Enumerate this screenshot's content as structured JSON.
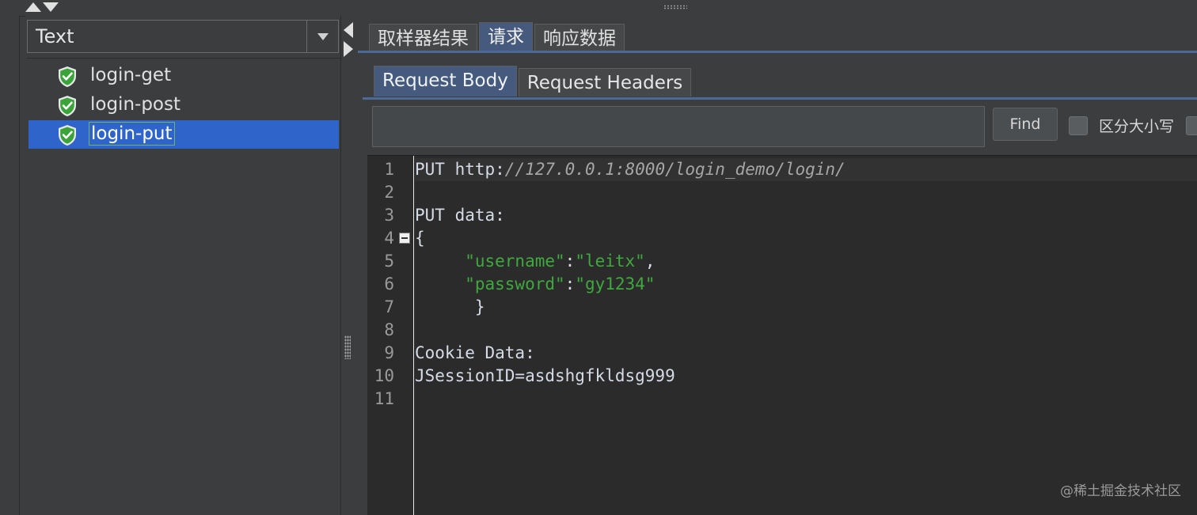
{
  "left_panel": {
    "renderer_select": {
      "value": "Text"
    },
    "tree_items": [
      {
        "label": "login-get",
        "status": "success"
      },
      {
        "label": "login-post",
        "status": "success"
      },
      {
        "label": "login-put",
        "status": "success",
        "selected": true
      }
    ]
  },
  "outer_tabs": [
    {
      "label": "取样器结果"
    },
    {
      "label": "请求",
      "active": true
    },
    {
      "label": "响应数据"
    }
  ],
  "inner_tabs": [
    {
      "label": "Request Body",
      "active": true
    },
    {
      "label": "Request Headers"
    }
  ],
  "search": {
    "value": "",
    "find_label": "Find",
    "case_sensitive_label": "区分大小写"
  },
  "editor": {
    "line_numbers": [
      "1",
      "2",
      "3",
      "4",
      "5",
      "6",
      "7",
      "8",
      "9",
      "10",
      "11"
    ],
    "lines": {
      "l1_method": "PUT ",
      "l1_scheme": "http:",
      "l1_rest": "//127.0.0.1:8000/login_demo/login/",
      "l3": "PUT data:",
      "l4": "{",
      "l5_indent": "     ",
      "l5_key": "\"username\"",
      "l5_colon": ":",
      "l5_val": "\"leitx\"",
      "l5_comma": ",",
      "l6_indent": "     ",
      "l6_key": "\"password\"",
      "l6_colon": ":",
      "l6_val": "\"gy1234\"",
      "l7": "      }",
      "l9": "Cookie Data:",
      "l10": "JSessionID=asdshgfkldsg999"
    }
  },
  "watermark": "@稀土掘金技术社区",
  "colors": {
    "selection": "#2f65ca",
    "tab_active": "#455a7d",
    "string_green": "#3fa83f",
    "shield_green": "#3aa43a"
  }
}
